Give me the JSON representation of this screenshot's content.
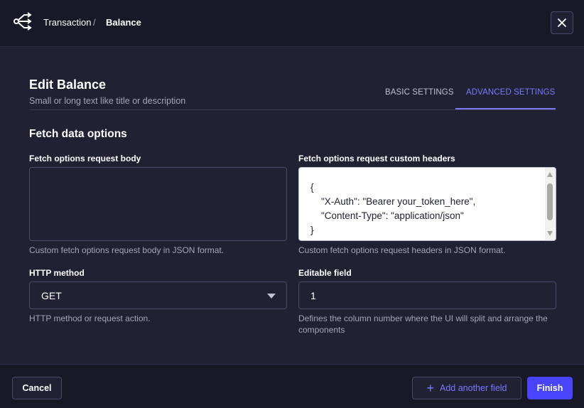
{
  "header": {
    "breadcrumb": [
      "Transaction",
      "/",
      "Balance"
    ],
    "close_icon": "close-icon"
  },
  "edit": {
    "title": "Edit Balance",
    "subtitle": "Small or long text like title or description",
    "tabs": [
      {
        "label": "BASIC SETTINGS",
        "active": false
      },
      {
        "label": "ADVANCED SETTINGS",
        "active": true
      }
    ]
  },
  "section": {
    "title": "Fetch data options"
  },
  "fields": {
    "body": {
      "label": "Fetch options request body",
      "value": "",
      "help": "Custom fetch options request body in JSON format."
    },
    "headers": {
      "label": "Fetch options request custom headers",
      "value": "{\n    \"X-Auth\": \"Bearer your_token_here\",\n    \"Content-Type\": \"application/json\"\n}",
      "help": "Custom fetch options request headers in JSON format."
    },
    "method": {
      "label": "HTTP method",
      "value": "GET",
      "help": "HTTP method or request action."
    },
    "editable": {
      "label": "Editable field",
      "value": "1",
      "help": "Defines the column number where the UI will split and arrange the components"
    }
  },
  "footer": {
    "cancel": "Cancel",
    "add": "Add another field",
    "finish": "Finish"
  },
  "colors": {
    "accent": "#7b79ff",
    "primary_button": "#4945ff",
    "background": "#212134",
    "header": "#181826"
  }
}
